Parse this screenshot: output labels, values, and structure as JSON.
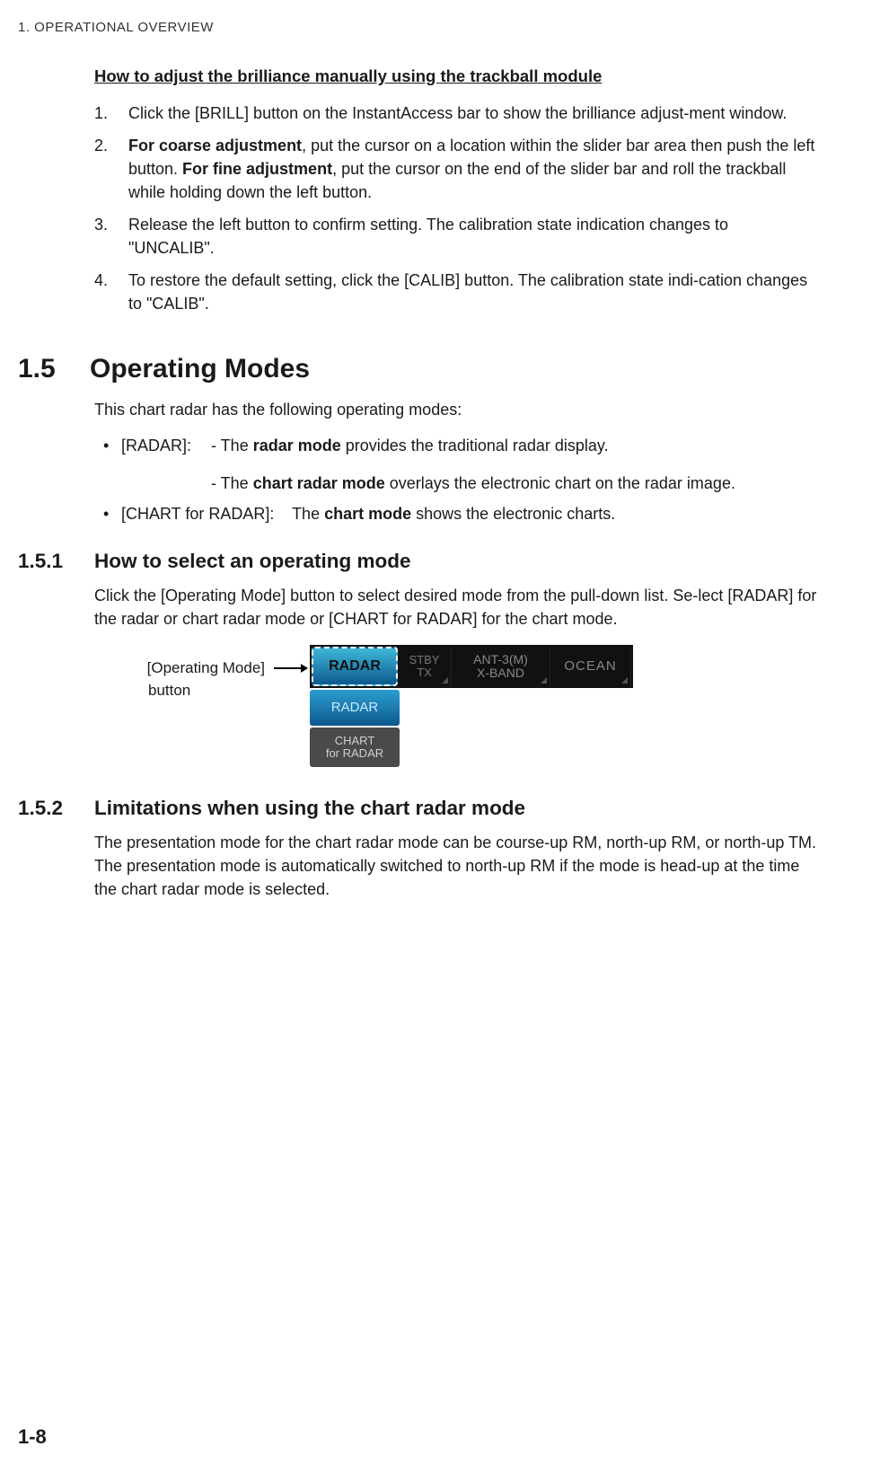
{
  "header": "1.  OPERATIONAL OVERVIEW",
  "sub_heading": "How to adjust the brilliance manually using the trackball module",
  "steps": {
    "s1": "Click the [BRILL] button on the InstantAccess bar to show the brilliance adjust-ment window.",
    "s2_b1": "For coarse adjustment",
    "s2_t1": ", put the cursor on a location within the slider bar area then push the left button. ",
    "s2_b2": "For fine adjustment",
    "s2_t2": ", put the cursor on the end of the slider bar and roll the trackball while holding down the left button.",
    "s3": "Release the left button to confirm setting. The calibration state indication changes to \"UNCALIB\".",
    "s4": "To restore the default setting, click the [CALIB] button. The calibration state indi-cation changes to \"CALIB\"."
  },
  "section_num": "1.5",
  "section_title": "Operating Modes",
  "section_intro": "This chart radar has the following operating modes:",
  "modes": {
    "m1_label": "[RADAR]:",
    "m1_l1_pre": "- The ",
    "m1_l1_b": "radar mode",
    "m1_l1_post": " provides the traditional radar display.",
    "m1_l2_pre": "- The ",
    "m1_l2_b": "chart radar mode",
    "m1_l2_post": " overlays the electronic chart on the radar image.",
    "m2_label": "[CHART for RADAR]:",
    "m2_pre": "The ",
    "m2_b": "chart mode",
    "m2_post": " shows the electronic charts."
  },
  "sub1_num": "1.5.1",
  "sub1_title": "How to select an operating mode",
  "sub1_body": "Click the [Operating Mode] button to select desired mode from the pull-down list. Se-lect [RADAR] for the radar or chart radar mode or [CHART for RADAR] for the chart mode.",
  "fig": {
    "caption_l1": "[Operating Mode]",
    "caption_l2": "button",
    "btn_radar": "RADAR",
    "stby_l1": "STBY",
    "stby_l2": "TX",
    "ant_l1": "ANT-3(M)",
    "ant_l2": "X-BAND",
    "ocean": "OCEAN",
    "dd_radar": "RADAR",
    "dd_chart_l1": "CHART",
    "dd_chart_l2": "for RADAR"
  },
  "sub2_num": "1.5.2",
  "sub2_title": "Limitations when using the chart radar mode",
  "sub2_body": "The presentation mode for the chart radar mode can be course-up RM, north-up RM, or north-up TM. The presentation mode is automatically switched to north-up RM if the mode is head-up at the time the chart radar mode is selected.",
  "page_num": "1-8"
}
